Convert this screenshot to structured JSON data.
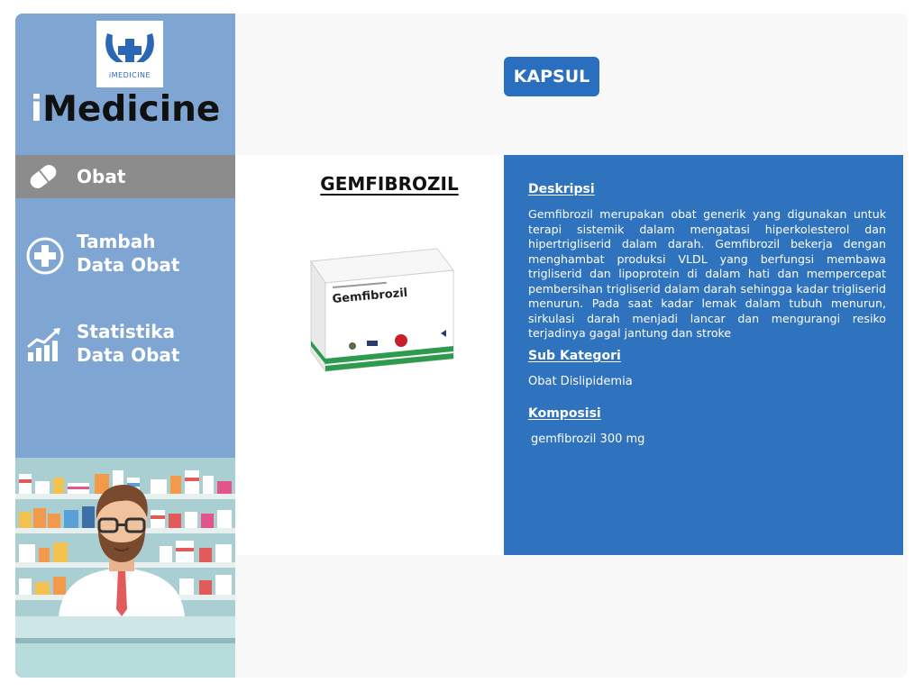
{
  "brand": {
    "prefix": "i",
    "name": "Medicine",
    "logo_caption": "iMEDICINE",
    "logo_icon": "hands-plus-icon"
  },
  "sidebar": {
    "items": [
      {
        "label_line1": "Obat",
        "label_line2": "",
        "icon": "pill-icon",
        "active": true
      },
      {
        "label_line1": "Tambah",
        "label_line2": "Data Obat",
        "icon": "plus-circle-icon",
        "active": false
      },
      {
        "label_line1": "Statistika",
        "label_line2": "Data Obat",
        "icon": "chart-growth-icon",
        "active": false
      }
    ]
  },
  "header": {
    "category": "KAPSUL"
  },
  "product": {
    "name": "GEMFIBROZIL",
    "box_label": "Gemfibrozil"
  },
  "details": {
    "description_heading": "Deskripsi",
    "description": "Gemfibrozil merupakan obat generik yang digunakan untuk terapi sistemik dalam mengatasi hiperkolesterol dan hipertrigliserid dalam darah. Gemfibrozil bekerja dengan menghambat produksi VLDL yang berfungsi membawa trigliserid dan lipoprotein di dalam hati dan mempercepat pembersihan trigliserid dalam darah sehingga kadar trigliserid menurun. Pada saat kadar lemak dalam tubuh menurun, sirkulasi darah menjadi lancar dan mengurangi resiko terjadinya gagal jantung dan stroke",
    "subcategory_heading": "Sub Kategori",
    "subcategory": "Obat Dislipidemia",
    "composition_heading": "Komposisi",
    "composition": "gemfibrozil 300 mg"
  },
  "colors": {
    "sidebar": "#7fa5d3",
    "active_nav": "#8c8c8c",
    "accent": "#2a6ebf",
    "detail_panel": "#2f72bd"
  }
}
